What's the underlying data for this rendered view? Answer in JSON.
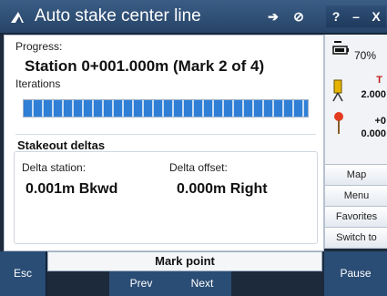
{
  "titlebar": {
    "title": "Auto stake center line",
    "icons": [
      "app-icon",
      "go-to-icon",
      "settings-icon"
    ],
    "window_buttons": [
      "?",
      "–",
      "X"
    ]
  },
  "main": {
    "progress_label": "Progress:",
    "station_line": "Station 0+001.000m (Mark 2 of 4)",
    "iterations_label": "Iterations",
    "iterations_progress": 1.0,
    "stakeout": {
      "title": "Stakeout deltas",
      "delta_station_label": "Delta station:",
      "delta_station_value": "0.001m Bkwd",
      "delta_offset_label": "Delta offset:",
      "delta_offset_value": "0.000m Right"
    }
  },
  "status": {
    "battery_percent": "70%",
    "height_marker": "T",
    "height_value": "2.000",
    "offset_value_1": "+0",
    "offset_value_2": "0.000",
    "colors": {
      "accent": "#2f7fd6",
      "marker": "#c21d1d"
    }
  },
  "menu": {
    "map": "Map",
    "menu": "Menu",
    "favorites": "Favorites",
    "switch_to": "Switch to"
  },
  "softkeys": {
    "esc": "Esc",
    "mark_point": "Mark point",
    "prev": "Prev",
    "next": "Next",
    "pause": "Pause"
  }
}
